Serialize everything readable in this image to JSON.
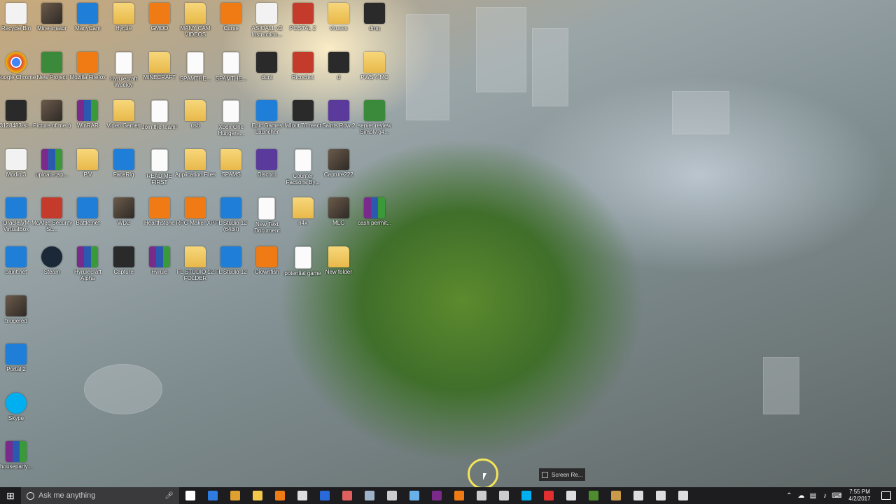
{
  "desktop": {
    "columns": [
      [
        {
          "label": "Recycle Bin",
          "icon": "recycle-bin-icon",
          "style": "g-white"
        },
        {
          "label": "Google Chrome",
          "icon": "chrome-icon",
          "style": "g-chrome"
        },
        {
          "label": "3128483-st...",
          "icon": "image-file-icon",
          "style": "g-dark"
        },
        {
          "label": "Modio 3",
          "icon": "modio-icon",
          "style": "g-white"
        },
        {
          "label": "Oracle VM VirtualBox",
          "icon": "virtualbox-icon",
          "style": "g-blue"
        },
        {
          "label": "paint.net",
          "icon": "paintnet-icon",
          "style": "g-blue"
        },
        {
          "label": "triggered",
          "icon": "image-file-icon",
          "style": "g-photo"
        },
        {
          "label": "Portal 2",
          "icon": "portal2-icon",
          "style": "g-blue"
        },
        {
          "label": "Skype",
          "icon": "skype-icon",
          "style": "g-skype"
        },
        {
          "label": "houseparty...",
          "icon": "winrar-archive-icon",
          "style": "g-rar"
        }
      ],
      [
        {
          "label": "Mine-imator",
          "icon": "mine-imator-icon",
          "style": "g-photo"
        },
        {
          "label": "New Project",
          "icon": "video-file-icon",
          "style": "g-green"
        },
        {
          "label": "Picture of me :)",
          "icon": "image-file-icon",
          "style": "g-photo"
        },
        {
          "label": "upload-gsp...",
          "icon": "winrar-archive-icon",
          "style": "g-rar"
        },
        {
          "label": "McAfee Security Sc...",
          "icon": "mcafee-icon",
          "style": "g-red"
        },
        {
          "label": "Steam",
          "icon": "steam-icon",
          "style": "g-steam"
        }
      ],
      [
        {
          "label": "ManyCam",
          "icon": "manycam-icon",
          "style": "g-blue"
        },
        {
          "label": "Mozilla Firefox",
          "icon": "firefox-icon",
          "style": "g-orange"
        },
        {
          "label": "WinRAR",
          "icon": "winrar-icon",
          "style": "g-rar"
        },
        {
          "label": "P.V",
          "icon": "folder-icon",
          "style": "g-folder"
        },
        {
          "label": "Battle.net",
          "icon": "battlenet-icon",
          "style": "g-blue"
        },
        {
          "label": "Hyrulecraft Alpha",
          "icon": "winrar-archive-icon",
          "style": "g-rar"
        }
      ],
      [
        {
          "label": "Hyrule",
          "icon": "folder-icon",
          "style": "g-folder"
        },
        {
          "label": "Hyrulecraft Weekly",
          "icon": "text-file-icon",
          "style": "g-file"
        },
        {
          "label": "Video Games",
          "icon": "folder-icon",
          "style": "g-folder"
        },
        {
          "label": "FaceRig",
          "icon": "facerig-icon",
          "style": "g-blue"
        },
        {
          "label": "WD2",
          "icon": "image-file-icon",
          "style": "g-photo"
        },
        {
          "label": "Capture",
          "icon": "image-file-icon",
          "style": "g-dark"
        }
      ],
      [
        {
          "label": "GMOD",
          "icon": "gmod-icon",
          "style": "g-orange"
        },
        {
          "label": "MINECRAFT",
          "icon": "folder-icon",
          "style": "g-folder"
        },
        {
          "label": "Join the team!",
          "icon": "text-file-icon",
          "style": "g-file"
        },
        {
          "label": "READ ME FIRST",
          "icon": "text-file-icon",
          "style": "g-file"
        },
        {
          "label": "Hearthstone",
          "icon": "hearthstone-icon",
          "style": "g-orange"
        },
        {
          "label": "Hyrule",
          "icon": "winrar-archive-icon",
          "style": "g-rar"
        }
      ],
      [
        {
          "label": "MANY CAM VIDEOS",
          "icon": "folder-icon",
          "style": "g-folder"
        },
        {
          "label": "SPAMTHE...",
          "icon": "text-file-icon",
          "style": "g-file"
        },
        {
          "label": "usb",
          "icon": "folder-icon",
          "style": "g-folder"
        },
        {
          "label": "Application Files",
          "icon": "folder-icon",
          "style": "g-folder"
        },
        {
          "label": "RPG Maker XP",
          "icon": "rpgmaker-icon",
          "style": "g-orange"
        },
        {
          "label": "FL STUDIO 12 FOLDER",
          "icon": "folder-icon",
          "style": "g-folder"
        }
      ],
      [
        {
          "label": "Curse",
          "icon": "curse-icon",
          "style": "g-orange"
        },
        {
          "label": "SPAMTHE...",
          "icon": "text-file-icon",
          "style": "g-file"
        },
        {
          "label": "Xbox One Hungere...",
          "icon": "text-file-icon",
          "style": "g-file"
        },
        {
          "label": "SPAMS",
          "icon": "folder-icon",
          "style": "g-folder"
        },
        {
          "label": "FL Studio 12 (64bit)",
          "icon": "flstudio-icon",
          "style": "g-blue"
        },
        {
          "label": "FL Studio 12",
          "icon": "flstudio-icon",
          "style": "g-blue"
        }
      ],
      [
        {
          "label": "ASIOALL v2 Instruction...",
          "icon": "pdf-icon",
          "style": "g-white"
        },
        {
          "label": "dont",
          "icon": "image-file-icon",
          "style": "g-dark"
        },
        {
          "label": "Epic Games Launcher",
          "icon": "epic-games-icon",
          "style": "g-blue"
        },
        {
          "label": "Discord",
          "icon": "discord-icon",
          "style": "g-purple"
        },
        {
          "label": "New Text Document",
          "icon": "text-file-icon",
          "style": "g-file"
        },
        {
          "label": "Clownfish",
          "icon": "clownfish-icon",
          "style": "g-orange"
        }
      ],
      [
        {
          "label": "POSTAL 2",
          "icon": "postal2-icon",
          "style": "g-red"
        },
        {
          "label": "Ricochet",
          "icon": "ricochet-icon",
          "style": "g-red"
        },
        {
          "label": "fallout 76 react",
          "icon": "video-file-icon",
          "style": "g-dark"
        },
        {
          "label": "Counter Factions By...",
          "icon": "text-file-icon",
          "style": "g-file"
        },
        {
          "label": "n4x",
          "icon": "folder-icon",
          "style": "g-folder"
        },
        {
          "label": "potential game",
          "icon": "text-file-icon",
          "style": "g-file"
        }
      ],
      [
        {
          "label": "viruses",
          "icon": "folder-icon",
          "style": "g-folder"
        },
        {
          "label": "d",
          "icon": "image-file-icon",
          "style": "g-dark"
        },
        {
          "label": "Saints Row 2",
          "icon": "saints-row-icon",
          "style": "g-purple"
        },
        {
          "label": "Capture222",
          "icon": "image-file-icon",
          "style": "g-photo"
        },
        {
          "label": "MLG",
          "icon": "image-file-icon",
          "style": "g-photo"
        },
        {
          "label": "New folder",
          "icon": "folder-icon",
          "style": "g-folder"
        }
      ],
      [
        {
          "label": "dmg",
          "icon": "image-file-icon",
          "style": "g-dark"
        },
        {
          "label": "PWS 4 MC",
          "icon": "folder-icon",
          "style": "g-folder"
        },
        {
          "label": "server review Simply g4...",
          "icon": "video-file-icon",
          "style": "g-green"
        },
        {
          "label": "",
          "icon": "",
          "style": ""
        },
        {
          "label": "cash permit...",
          "icon": "winrar-archive-icon",
          "style": "g-rar"
        }
      ]
    ]
  },
  "taskbar": {
    "start_icon": "windows-start-icon",
    "search_placeholder": "Ask me anything",
    "pinned_apps": [
      {
        "icon": "task-view-icon",
        "color": "#ffffff"
      },
      {
        "icon": "edge-icon",
        "color": "#2f7ce0"
      },
      {
        "icon": "chrome-icon",
        "color": "#e0a030"
      },
      {
        "icon": "file-explorer-icon",
        "color": "#f2c84b"
      },
      {
        "icon": "firefox-icon",
        "color": "#f07a14"
      },
      {
        "icon": "modio-icon",
        "color": "#dddddd"
      },
      {
        "icon": "flstudio-icon",
        "color": "#2a6ad8"
      },
      {
        "icon": "paint-icon",
        "color": "#e06060"
      },
      {
        "icon": "steam-icon",
        "color": "#9fb3c8"
      },
      {
        "icon": "xbox-notification-icon",
        "color": "#cccccc"
      },
      {
        "icon": "photo-viewer-icon",
        "color": "#6ab0e8"
      },
      {
        "icon": "winrar-icon",
        "color": "#7a2a8a"
      },
      {
        "icon": "gmod-icon",
        "color": "#f07a14"
      },
      {
        "icon": "security-icon",
        "color": "#cccccc"
      },
      {
        "icon": "settings-icon",
        "color": "#cccccc"
      },
      {
        "icon": "skype-icon",
        "color": "#00aff0"
      },
      {
        "icon": "record-icon",
        "color": "#e23030"
      },
      {
        "icon": "xbox-icon",
        "color": "#dddddd"
      },
      {
        "icon": "minecraft-icon",
        "color": "#4e8a2e"
      },
      {
        "icon": "box-icon",
        "color": "#c89a4a"
      },
      {
        "icon": "terminal-icon",
        "color": "#dddddd"
      },
      {
        "icon": "photos-icon",
        "color": "#dddddd"
      },
      {
        "icon": "mixer-icon",
        "color": "#dddddd"
      }
    ],
    "tray": {
      "icons": [
        "chevron-up-icon",
        "cloud-icon",
        "network-icon",
        "volume-icon",
        "keyboard-icon"
      ],
      "time": "7:55 PM",
      "date": "4/2/2017"
    }
  },
  "popup": {
    "label": "Screen Re..."
  }
}
